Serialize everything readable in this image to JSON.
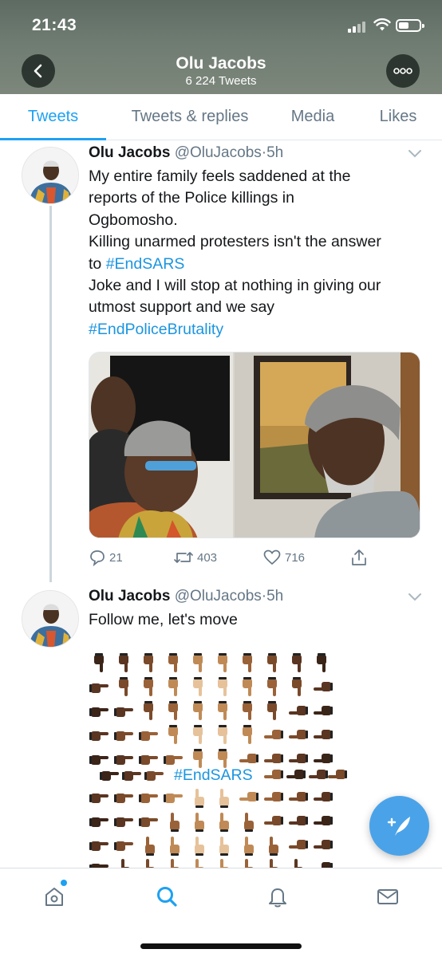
{
  "status_bar": {
    "time": "21:43"
  },
  "profile": {
    "name": "Olu Jacobs",
    "tweet_count": "6 224 Tweets"
  },
  "tabs": [
    {
      "label": "Tweets",
      "active": true
    },
    {
      "label": "Tweets & replies",
      "active": false
    },
    {
      "label": "Media",
      "active": false
    },
    {
      "label": "Likes",
      "active": false
    }
  ],
  "tweets": [
    {
      "name": "Olu Jacobs",
      "handle": "@OluJacobs",
      "separator": "·",
      "time": "5h",
      "lines": [
        "My entire family feels saddened at the",
        "reports of the Police killings in",
        "Ogbomosho.",
        "Killing unarmed protesters isn't the answer",
        "to ",
        "Joke and I will stop at nothing in giving our",
        "utmost support and we say"
      ],
      "hashtag_endsars": "#EndSARS",
      "hashtag_brutality": "#EndPoliceBrutality",
      "actions": {
        "replies": "21",
        "retweets": "403",
        "likes": "716"
      }
    },
    {
      "name": "Olu Jacobs",
      "handle": "@OluJacobs",
      "separator": "·",
      "time": "5h",
      "text": "Follow me, let's move",
      "hashtag": "#EndSARS"
    }
  ],
  "colors": {
    "accent": "#1da1f2",
    "hashtag": "#1b95e0",
    "secondary_text": "#657786"
  },
  "icons": {
    "back": "chevron-left-icon",
    "more": "ellipsis-icon",
    "reply": "speech-bubble-icon",
    "retweet": "retweet-icon",
    "like": "heart-icon",
    "share": "share-icon",
    "compose": "feather-plus-icon",
    "nav": [
      "home-icon",
      "search-icon",
      "bell-icon",
      "mail-icon"
    ]
  }
}
